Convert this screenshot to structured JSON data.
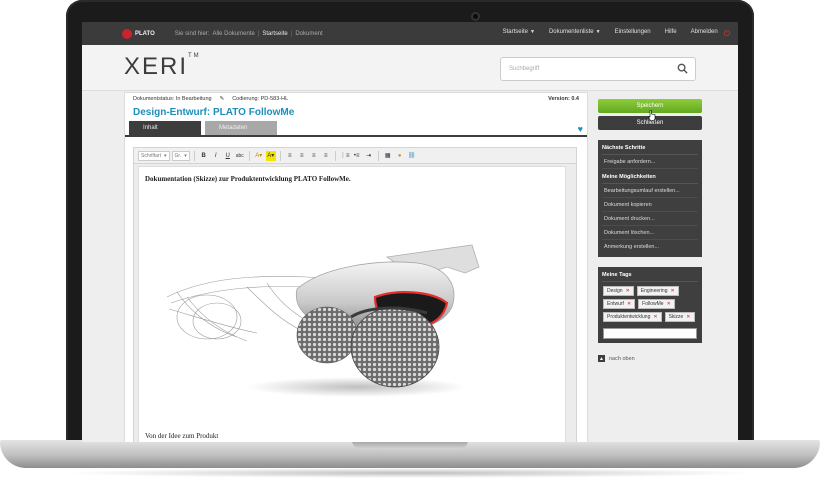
{
  "topbar": {
    "logo": "PLATO",
    "breadcrumb_prefix": "Sie sind hier:",
    "breadcrumb": [
      "Alle Dokumente",
      "Startseite",
      "Dokument"
    ],
    "nav": [
      "Startseite",
      "Dokumentenliste",
      "Einstellungen",
      "Hilfe",
      "Abmelden"
    ]
  },
  "header": {
    "logo": "XERI",
    "logo_tm": "TM",
    "search_placeholder": "Suchbegriff"
  },
  "document": {
    "status": "Dokumentstatus: In Bearbeitung",
    "code": "Codierung: PD-583-HL",
    "version": "Version: 0.4",
    "title": "Design-Entwurf: PLATO FollowMe",
    "tabs": [
      "Inhalt",
      "Metadaten"
    ],
    "toolbar_selects": [
      "Schriftart",
      "Gr."
    ],
    "heading": "Dokumentation (Skizze) zur Produktentwicklung PLATO FollowMe.",
    "caption": "Von der Idee zum Produkt"
  },
  "sidebar": {
    "save": "Speichern",
    "close": "Schließen",
    "next_steps_title": "Nächste Schritte",
    "next_steps": [
      "Freigabe anfordern..."
    ],
    "options_title": "Meine Möglichkeiten",
    "options": [
      "Bearbeitungsumlauf erstellen...",
      "Dokument kopieren",
      "Dokument drucken...",
      "Dokument löschen...",
      "Anmerkung erstellen..."
    ],
    "tags_title": "Meine Tags",
    "tags": [
      "Design",
      "Engineering",
      "Entwurf",
      "FollowMe",
      "Produktentwicklung",
      "Skizze"
    ],
    "back_to_top": "nach oben"
  },
  "colors": {
    "accent_blue": "#1e8fbc",
    "save_green": "#6ab02a",
    "brand_red": "#c9232d",
    "dark_panel": "#3f3f3f"
  }
}
